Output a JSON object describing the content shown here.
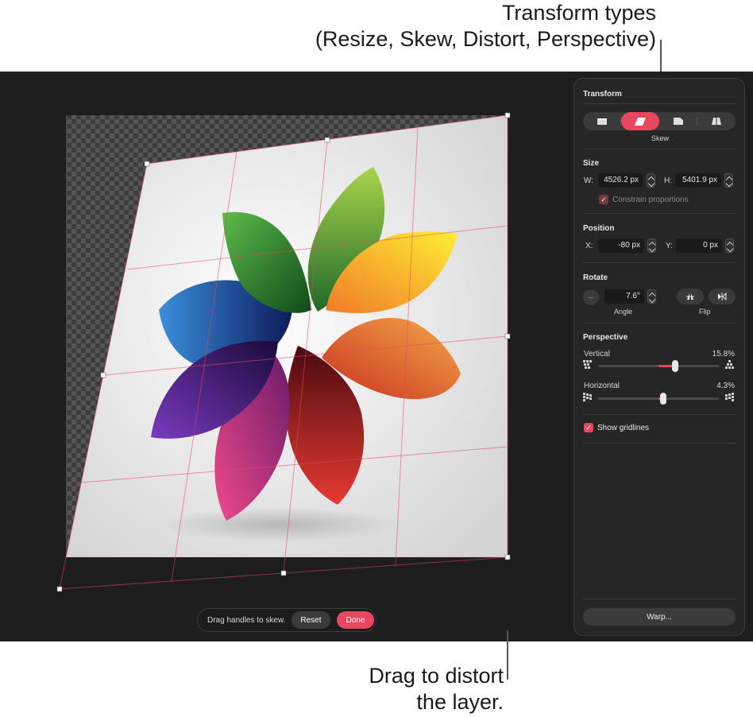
{
  "callouts": {
    "top_line1": "Transform types",
    "top_line2": "(Resize, Skew, Distort, Perspective)",
    "bottom_line1": "Drag to distort",
    "bottom_line2": "the layer."
  },
  "toolbar": {
    "hint": "Drag handles to skew.",
    "reset_label": "Reset",
    "done_label": "Done"
  },
  "panel": {
    "title": "Transform",
    "transform_types": [
      "resize-icon",
      "skew-icon",
      "distort-icon",
      "perspective-icon"
    ],
    "active_type_label": "Skew",
    "size": {
      "title": "Size",
      "w_label": "W:",
      "w_value": "4526.2 px",
      "h_label": "H:",
      "h_value": "5401.9 px",
      "constrain_label": "Constrain proportions"
    },
    "position": {
      "title": "Position",
      "x_label": "X:",
      "x_value": "-80 px",
      "y_label": "Y:",
      "y_value": "0 px"
    },
    "rotate": {
      "title": "Rotate",
      "angle_value": "7.6°",
      "angle_label": "Angle",
      "flip_label": "Flip"
    },
    "perspective": {
      "title": "Perspective",
      "vertical_label": "Vertical",
      "vertical_value": "15.8%",
      "vertical_fraction": 0.158,
      "horizontal_label": "Horizontal",
      "horizontal_value": "4.3%",
      "horizontal_fraction": 0.043
    },
    "gridlines_label": "Show gridlines",
    "warp_label": "Warp..."
  },
  "colors": {
    "accent": "#e8475f",
    "panel_bg": "#262626",
    "canvas_bg": "#1e1e1e"
  }
}
